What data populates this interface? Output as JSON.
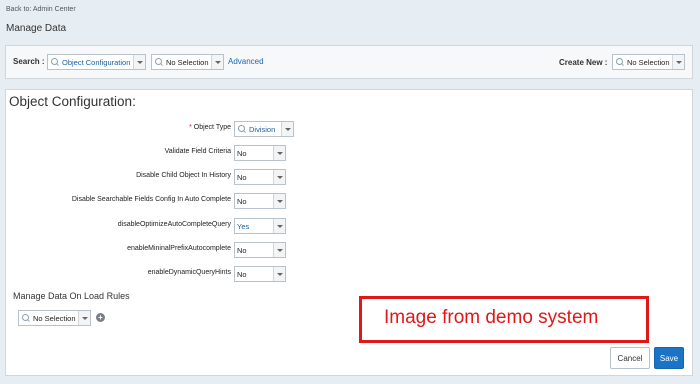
{
  "header": {
    "back_link": "Back to: Admin Center",
    "page_title": "Manage Data"
  },
  "search_bar": {
    "search_label": "Search :",
    "search_type_value": "Object Configuration",
    "search_object_value": "No Selection",
    "advanced_link": "Advanced",
    "create_new_label": "Create New :",
    "create_new_value": "No Selection"
  },
  "panel": {
    "title": "Object Configuration:",
    "required_marker": "*",
    "fields": [
      {
        "label": "Object Type",
        "value": "Division",
        "required": true
      },
      {
        "label": "Validate Field Criteria",
        "value": "No"
      },
      {
        "label": "Disable Child Object In History",
        "value": "No"
      },
      {
        "label": "Disable Searchable Fields Config In Auto Complete",
        "value": "No"
      },
      {
        "label": "disableOptimizeAutoCompleteQuery",
        "value": "Yes"
      },
      {
        "label": "enableMininalPrefixAutocomplete",
        "value": "No"
      },
      {
        "label": "enableDynamicQueryHints",
        "value": "No"
      }
    ],
    "load_rules": {
      "title": "Manage Data On Load Rules",
      "value": "No Selection",
      "add_symbol": "+"
    }
  },
  "watermark": {
    "text": "Image from demo system",
    "color": "#e01818"
  },
  "buttons": {
    "cancel": "Cancel",
    "save": "Save"
  },
  "colors": {
    "accent": "#1a73c5",
    "link": "#1a68b3",
    "background": "#e7eef3"
  }
}
